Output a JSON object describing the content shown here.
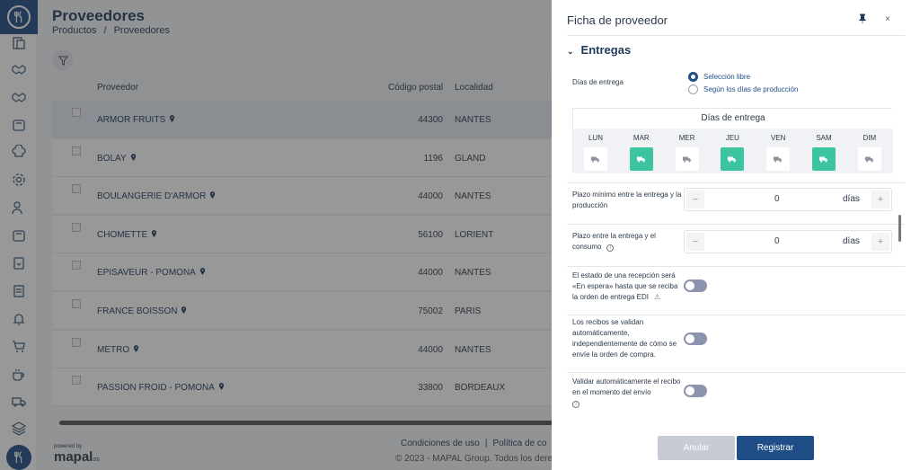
{
  "app": {
    "logo_label": "⌖"
  },
  "sidebar": {
    "icons": [
      "documents-icon",
      "handshake-icon",
      "handshake-alt-icon",
      "box-icon",
      "chef-hat-icon",
      "gear-icon",
      "users-icon",
      "box-alt-icon",
      "clipboard-heart-icon",
      "invoice-icon",
      "bell-icon",
      "cart-icon",
      "coffee-icon",
      "truck-icon",
      "layers-icon"
    ]
  },
  "page": {
    "title": "Proveedores",
    "breadcrumb": [
      "Productos",
      "Proveedores"
    ],
    "breadcrumb_sep": "/"
  },
  "table": {
    "headers": {
      "name": "Proveedor",
      "cp": "Código postal",
      "loc": "Localidad"
    },
    "rows": [
      {
        "name": "ARMOR FRUITS",
        "cp": "44300",
        "loc": "NANTES",
        "selected": true
      },
      {
        "name": "BOLAY",
        "cp": "1196",
        "loc": "GLAND"
      },
      {
        "name": "BOULANGERIE D'ARMOR",
        "cp": "44000",
        "loc": "NANTES"
      },
      {
        "name": "CHOMETTE",
        "cp": "56100",
        "loc": "LORIENT"
      },
      {
        "name": "EPISAVEUR - POMONA",
        "cp": "44000",
        "loc": "NANTES"
      },
      {
        "name": "FRANCE BOISSON",
        "cp": "75002",
        "loc": "PARIS"
      },
      {
        "name": "METRO",
        "cp": "44000",
        "loc": "NANTES"
      },
      {
        "name": "PASSION FROID - POMONA",
        "cp": "33800",
        "loc": "BORDEAUX"
      }
    ]
  },
  "footer": {
    "link1": "Condiciones de uso",
    "sep": "|",
    "link2": "Política de co",
    "copyright": "© 2023 - MAPAL Group. Todos los dere",
    "powered": "powered by",
    "brand": "mapal",
    "brand_suffix": "os"
  },
  "panel": {
    "title": "Ficha de proveedor",
    "close": "×",
    "section": "Entregas",
    "delivery_days_label": "Días de entrega",
    "radio1": "Selección libre",
    "radio2": "Según los días de producción",
    "days_title": "Días de entrega",
    "days": [
      {
        "label": "LUN",
        "active": false
      },
      {
        "label": "MAR",
        "active": true
      },
      {
        "label": "MER",
        "active": false
      },
      {
        "label": "JEU",
        "active": true
      },
      {
        "label": "VEN",
        "active": false
      },
      {
        "label": "SAM",
        "active": true
      },
      {
        "label": "DIM",
        "active": false
      }
    ],
    "min_delay_label": "Plazo mínimo entre la entrega y la producción",
    "min_delay_value": "0",
    "unit": "días",
    "minus": "−",
    "plus": "+",
    "consumption_label": "Plazo entre la entrega y el consumo",
    "consumption_value": "0",
    "edi_label": "El estado de una recepción será «En espera» hasta que se reciba la orden de entrega EDI",
    "auto_validate_label": "Los recibos se validan automáticamente, independientemente de cómo se envíe la orden de compra.",
    "validate_on_send_label": "Validar automáticamente el recibo en el momento del envío",
    "info_glyph": "i",
    "warn_glyph": "⚠",
    "cancel": "Anular",
    "save": "Registrar"
  },
  "colors": {
    "primary": "#1f4e86",
    "active_day": "#3cc4a0",
    "toggle_off": "#8b93ad"
  }
}
